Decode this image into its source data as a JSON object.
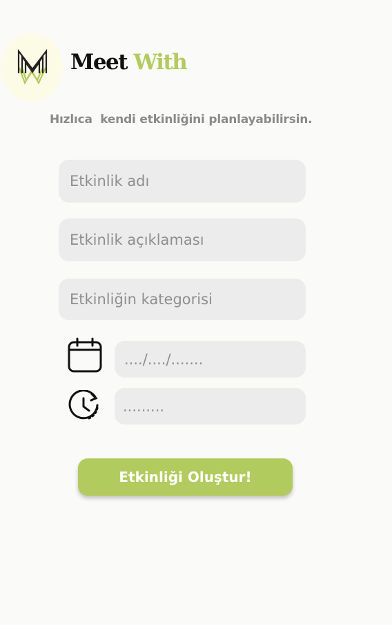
{
  "brand": {
    "word1": "Meet",
    "word2": "With",
    "logo_icon": "meetwith-logo-icon"
  },
  "subtitle": "Hızlıca  kendi etkinliğini planlayabilirsin.",
  "form": {
    "name_placeholder": "Etkinlik adı",
    "description_placeholder": "Etkinlik açıklaması",
    "category_placeholder": "Etkinliğin kategorisi",
    "date_placeholder": "..../..../.......",
    "time_placeholder": ".........",
    "date_icon": "calendar-icon",
    "time_icon": "clock-icon",
    "submit_label": "Etkinliği Oluştur!"
  },
  "colors": {
    "accent": "#b2cb5e",
    "field_bg": "#ececec",
    "background": "#fafaf8",
    "logo_bg": "#fbfbe6"
  }
}
